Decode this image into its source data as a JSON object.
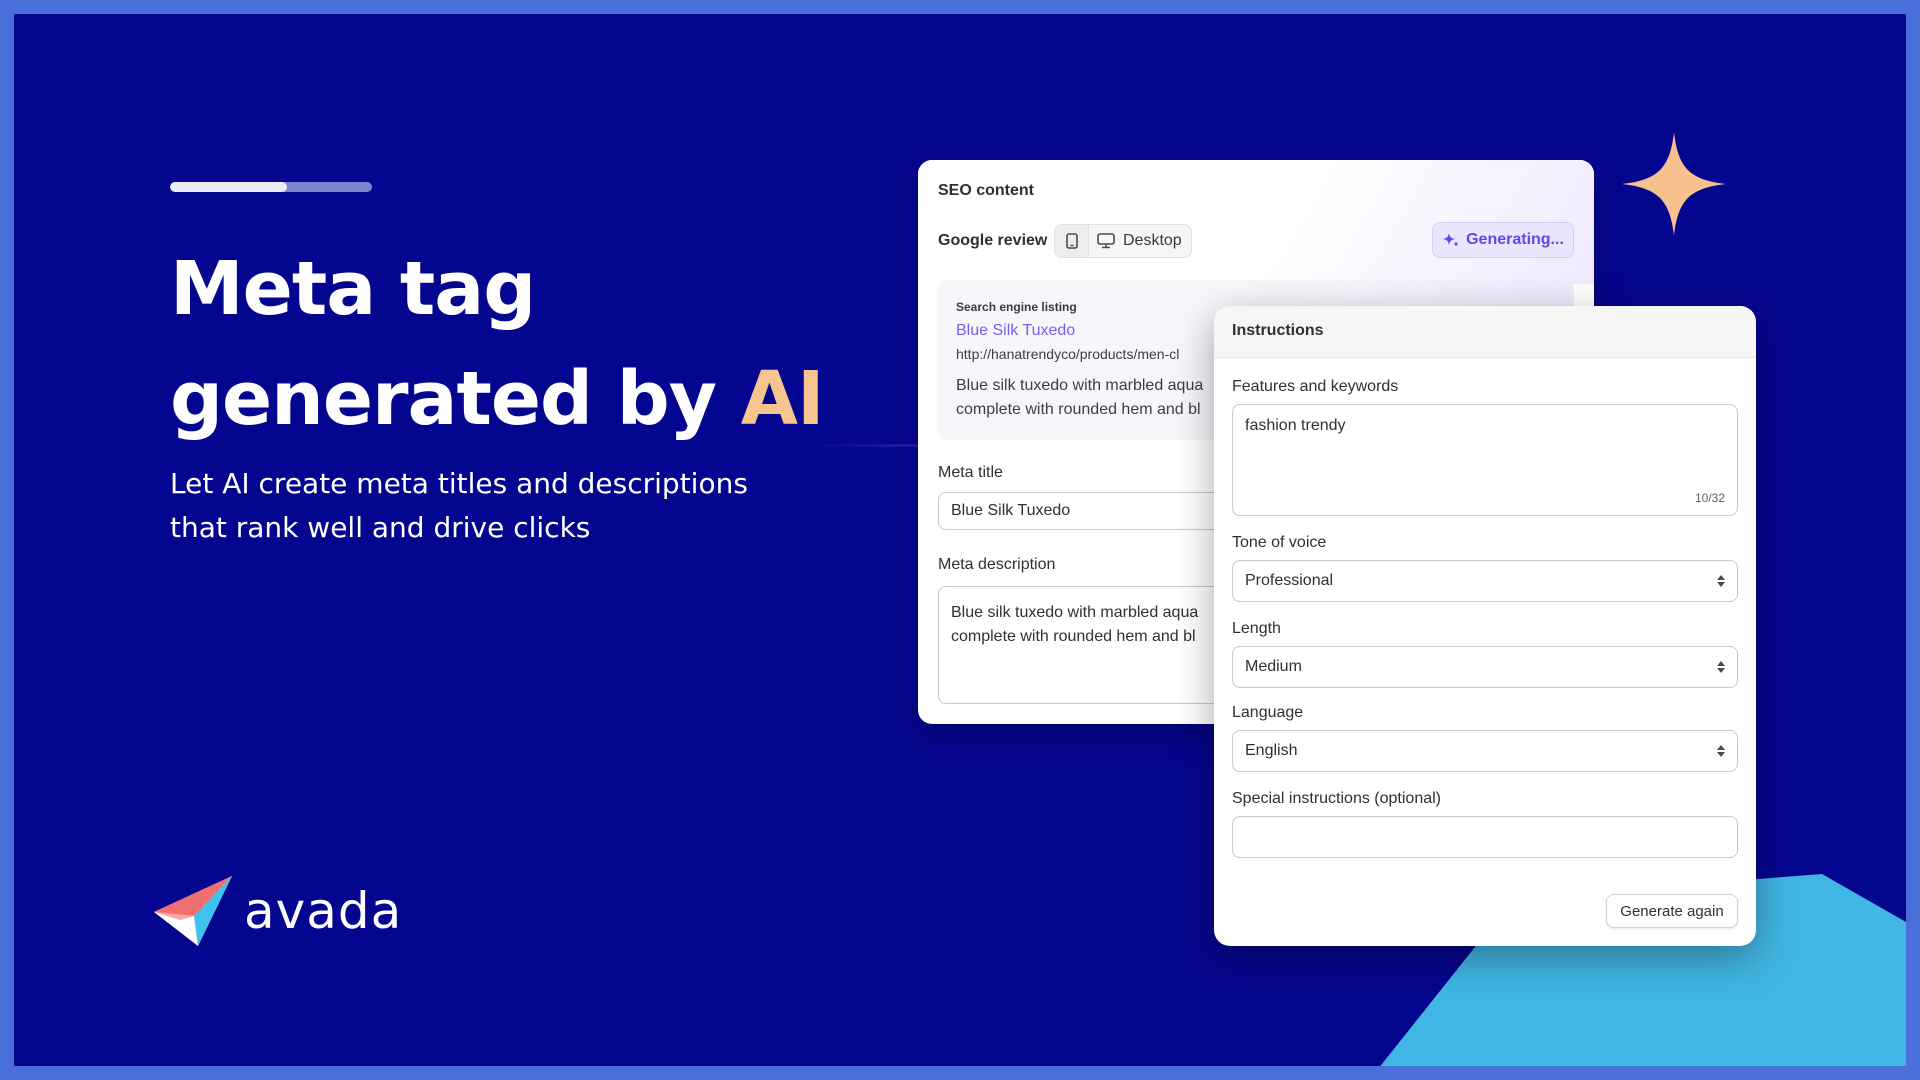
{
  "hero": {
    "progress_fraction": 0.58,
    "headline_line1": "Meta tag",
    "headline_line2_prefix": "generated by ",
    "headline_line2_ai": "AI",
    "subline_line1": "Let AI create meta titles and descriptions",
    "subline_line2": "that rank well and drive clicks"
  },
  "brand": {
    "logo_text": "avada",
    "logo_icon": "paper-plane-logo-icon",
    "accent_color": "#f6c58f",
    "background_color": "#05068f",
    "highlight_color": "#41b6e4"
  },
  "seo": {
    "title": "SEO content",
    "google_review_label": "Google review",
    "device_desktop_label": "Desktop",
    "generating_label": "Generating...",
    "listing": {
      "label": "Search engine listing",
      "title": "Blue Silk Tuxedo",
      "url": "http://hanatrendyco/products/men-cl",
      "description": "Blue silk tuxedo with marbled aqua complete with rounded hem and bl"
    },
    "meta_title_label": "Meta title",
    "meta_title_value": "Blue Silk Tuxedo",
    "meta_description_label": "Meta description",
    "meta_description_value": "Blue silk tuxedo with marbled aqua complete with rounded hem and bl"
  },
  "instructions": {
    "title": "Instructions",
    "features_label": "Features and keywords",
    "features_value": "fashion trendy",
    "features_count": "10/32",
    "tone_label": "Tone of voice",
    "tone_value": "Professional",
    "length_label": "Length",
    "length_value": "Medium",
    "language_label": "Language",
    "language_value": "English",
    "special_label": "Special instructions (optional)",
    "special_value": "",
    "generate_again_label": "Generate again"
  }
}
